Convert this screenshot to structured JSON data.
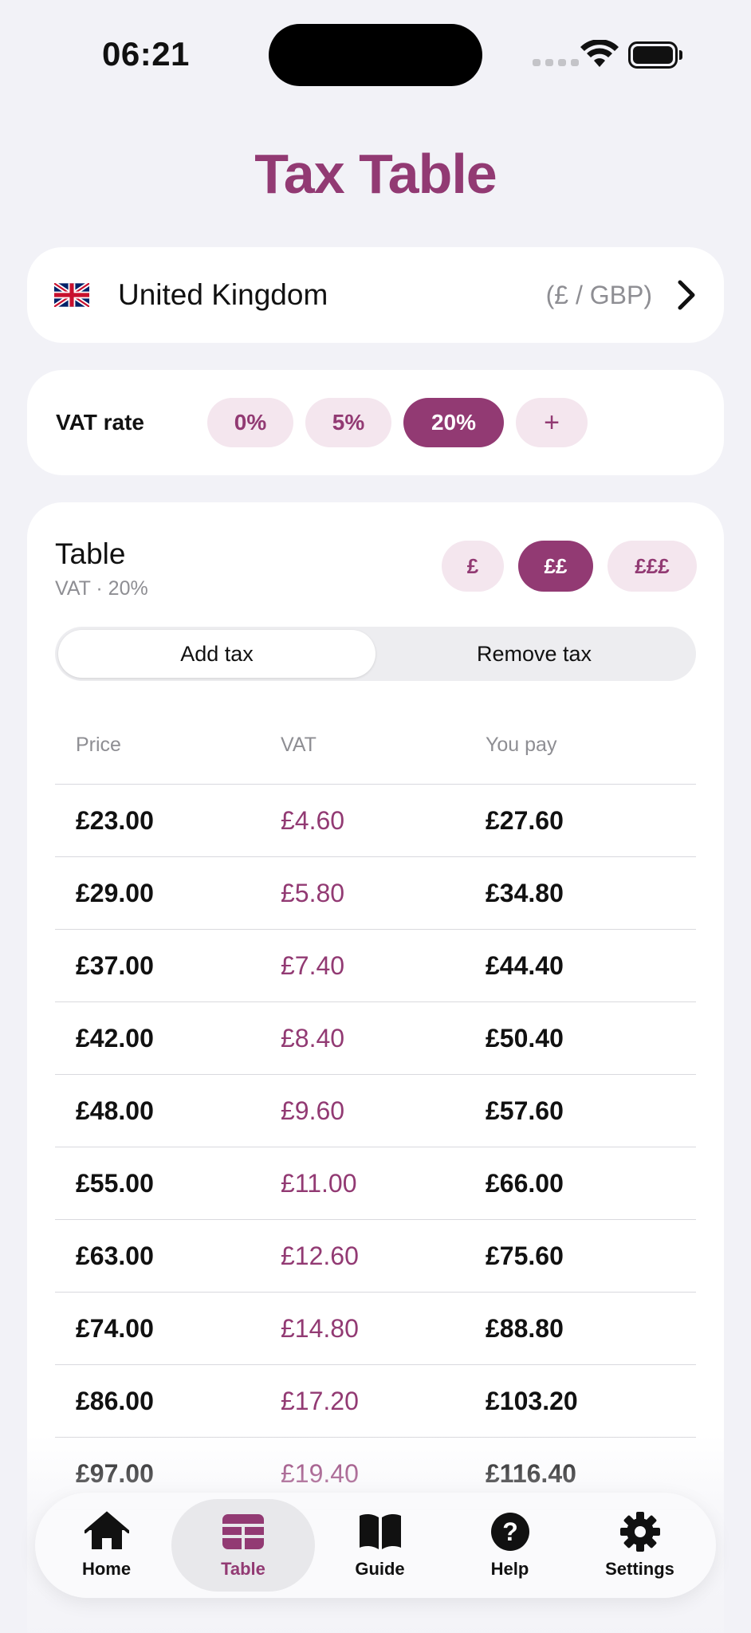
{
  "status": {
    "time": "06:21"
  },
  "title": "Tax Table",
  "country": {
    "name": "United Kingdom",
    "currency": "(£ / GBP)",
    "flag_icon": "uk-flag-icon"
  },
  "vat": {
    "label": "VAT rate",
    "options": [
      "0%",
      "5%",
      "20%",
      "+"
    ],
    "selected": "20%"
  },
  "table": {
    "title": "Table",
    "subtitle": "VAT · 20%",
    "rounding": [
      "£",
      "££",
      "£££"
    ],
    "rounding_selected": "££",
    "modes": [
      "Add tax",
      "Remove tax"
    ],
    "mode_selected": "Add tax",
    "columns": [
      "Price",
      "VAT",
      "You pay"
    ],
    "rows": [
      [
        "£23.00",
        "£4.60",
        "£27.60"
      ],
      [
        "£29.00",
        "£5.80",
        "£34.80"
      ],
      [
        "£37.00",
        "£7.40",
        "£44.40"
      ],
      [
        "£42.00",
        "£8.40",
        "£50.40"
      ],
      [
        "£48.00",
        "£9.60",
        "£57.60"
      ],
      [
        "£55.00",
        "£11.00",
        "£66.00"
      ],
      [
        "£63.00",
        "£12.60",
        "£75.60"
      ],
      [
        "£74.00",
        "£14.80",
        "£88.80"
      ],
      [
        "£86.00",
        "£17.20",
        "£103.20"
      ],
      [
        "£97.00",
        "£19.40",
        "£116.40"
      ]
    ]
  },
  "tabbar": {
    "items": [
      "Home",
      "Table",
      "Guide",
      "Help",
      "Settings"
    ],
    "selected": "Table"
  },
  "colors": {
    "accent": "#923a73",
    "accent_light": "#f4e6ee",
    "background": "#f2f2f7"
  }
}
